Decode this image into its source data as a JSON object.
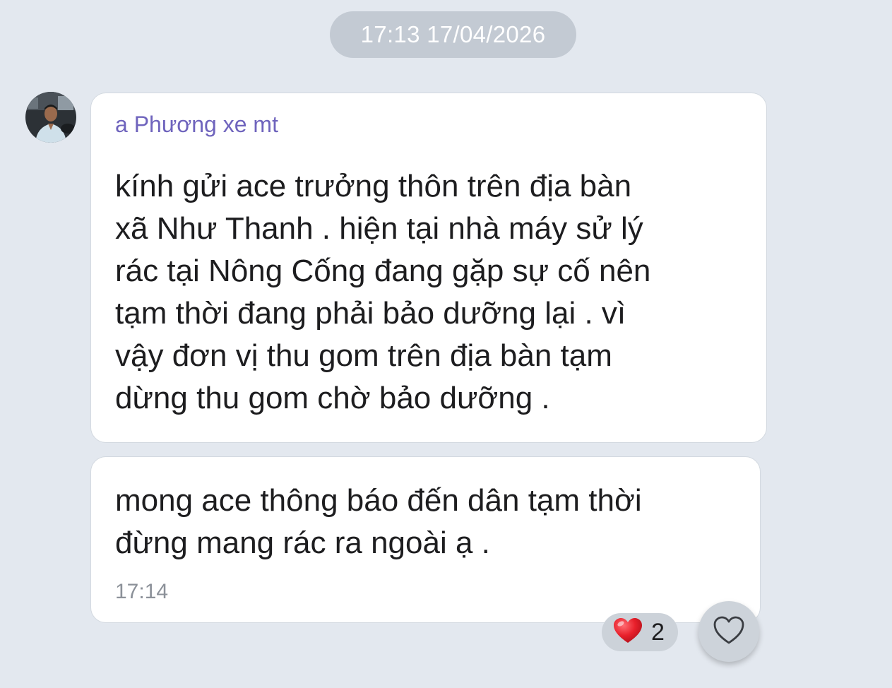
{
  "chat": {
    "date_separator": "17:13 17/04/2026",
    "messages": [
      {
        "sender": "a Phương xe mt",
        "lines": [
          "kính gửi ace trưởng thôn trên địa bàn",
          "xã Như Thanh . hiện tại nhà máy sử lý",
          "rác tại Nông Cống đang gặp sự cố nên",
          "tạm thời đang phải bảo dưỡng lại . vì",
          "vậy đơn vị thu gom trên địa bàn tạm",
          "dừng thu gom chờ bảo dưỡng ."
        ]
      },
      {
        "lines": [
          "mong ace thông báo đến dân tạm thời",
          "đừng mang rác ra ngoài ạ ."
        ],
        "time": "17:14"
      }
    ],
    "reaction": {
      "icon": "heart-emoji-icon",
      "count": "2"
    },
    "like_button_icon": "heart-outline-icon"
  }
}
